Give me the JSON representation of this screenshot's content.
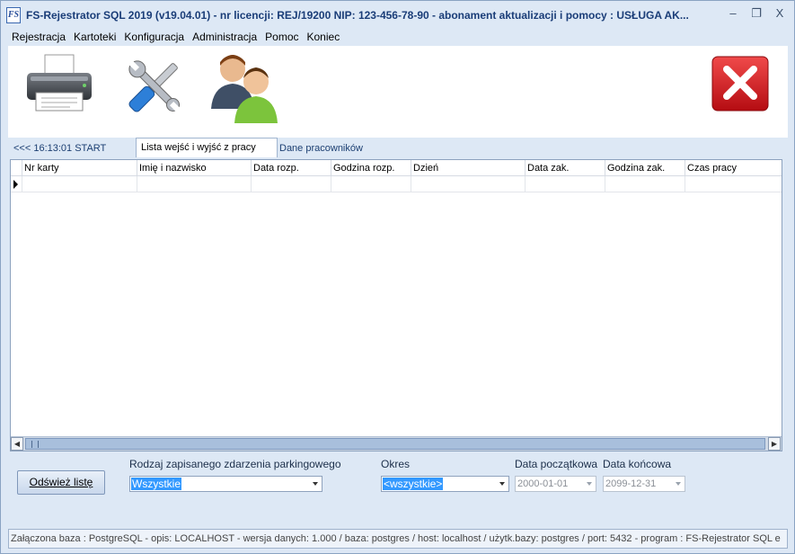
{
  "window": {
    "title": "FS-Rejestrator SQL 2019 (v19.04.01)    -    nr licencji: REJ/19200     NIP: 123-456-78-90    -   abonament aktualizacji i pomocy : USŁUGA AK...",
    "logo_text": "FS",
    "controls": {
      "minimize": "–",
      "maximize": "❐",
      "close": "X"
    }
  },
  "menu": {
    "items": [
      "Rejestracja",
      "Kartoteki",
      "Konfiguracja",
      "Administracja",
      "Pomoc",
      "Koniec"
    ]
  },
  "toolbar": {
    "icons": [
      "printer-icon",
      "tools-icon",
      "users-icon",
      "close-app-icon"
    ]
  },
  "tabs": {
    "session": "<<<  16:13:01  START",
    "items": [
      "Lista wejść i wyjść z pracy",
      "Dane pracowników"
    ],
    "active": "Lista wejść i wyjść z pracy"
  },
  "grid": {
    "columns": [
      "Nr karty",
      "Imię i nazwisko",
      "Data rozp.",
      "Godzina rozp.",
      "Dzień",
      "Data zak.",
      "Godzina zak.",
      "Czas pracy"
    ]
  },
  "filters": {
    "refresh_label": "Odśwież listę",
    "event_type": {
      "label": "Rodzaj zapisanego zdarzenia parkingowego",
      "value": "Wszystkie"
    },
    "period": {
      "label": "Okres",
      "value": "<wszystkie>"
    },
    "start_date": {
      "label": "Data początkowa",
      "value": "2000-01-01"
    },
    "end_date": {
      "label": "Data końcowa",
      "value": "2099-12-31"
    }
  },
  "status": {
    "text": "Załączona baza : PostgreSQL - opis: LOCALHOST - wersja danych: 1.000  / baza: postgres / host: localhost / użytk.bazy: postgres /  port: 5432  - program :  FS-Rejestrator SQL e"
  },
  "colors": {
    "accent": "#3399ff",
    "title_text": "#1a3d78",
    "window_bg": "#dde8f5",
    "close_red": "#d9141c"
  }
}
